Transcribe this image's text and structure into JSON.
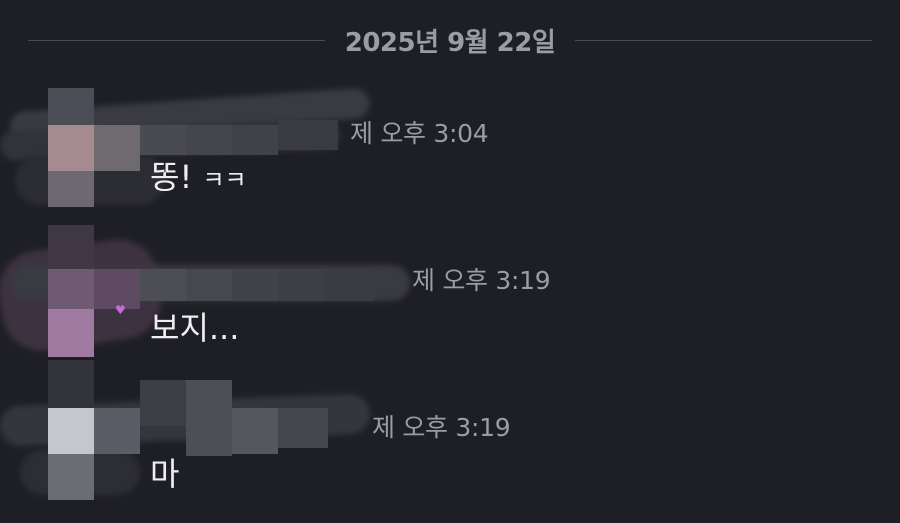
{
  "date_divider": {
    "label": "2025년 9월 22일"
  },
  "messages": [
    {
      "timestamp": "제 오후 3:04",
      "text": "똥!",
      "suffix": "ㅋㅋ"
    },
    {
      "timestamp": "제 오후 3:19",
      "text": "보지..."
    },
    {
      "timestamp": "제 오후 3:19",
      "text": "마"
    }
  ],
  "colors": {
    "background": "#1e1f24",
    "divider_line": "#4a4c55",
    "muted_text": "#9a9ca6",
    "message_text": "#eeeef2"
  }
}
